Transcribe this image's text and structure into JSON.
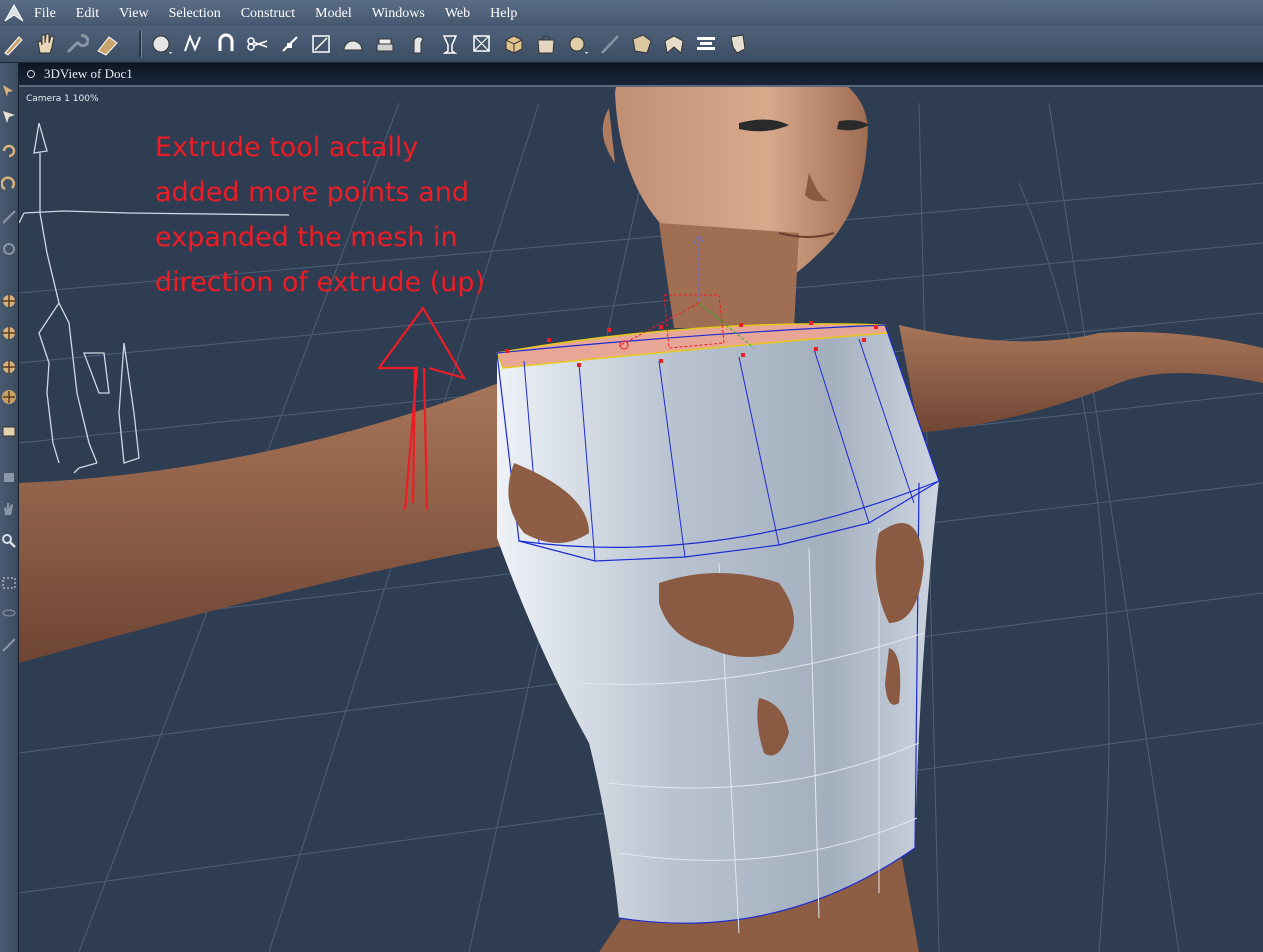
{
  "menubar": {
    "items": [
      "File",
      "Edit",
      "View",
      "Selection",
      "Construct",
      "Model",
      "Windows",
      "Web",
      "Help"
    ]
  },
  "toolbar": {
    "tools": [
      "paint-icon",
      "hand-icon",
      "wrench-icon",
      "eraser-icon",
      "sphere-icon",
      "polyline-icon",
      "magnet-icon",
      "scissors-icon",
      "pen-icon",
      "scale-icon",
      "dome-icon",
      "extrude-icon",
      "bend-icon",
      "lathe-icon",
      "box-x-icon",
      "cube-icon",
      "bag-icon",
      "globe-icon",
      "knife-icon",
      "move-icon",
      "fold-icon",
      "align-icon",
      "shard-icon"
    ],
    "highlighted_tool": "extrude-icon"
  },
  "leftbar": {
    "tools": [
      "arrow-icon",
      "select-icon",
      "rotate-icon",
      "twist-icon",
      "scale-tool-icon",
      "link-icon",
      "move-x-icon",
      "move-y-icon",
      "move-z-icon",
      "orbit-icon",
      "brush-icon",
      "lamp-icon",
      "hand-pan-icon",
      "zoom-icon",
      "marquee-icon",
      "eye-icon",
      "pencil-icon"
    ]
  },
  "viewport": {
    "title": "3DView of Doc1",
    "camera_label": "Camera 1 100%"
  },
  "annotation": {
    "text": "Extrude tool actally\nadded more points and\nexpanded the mesh in\ndirection of extrude (up)",
    "color": "#ee1c24"
  },
  "colors": {
    "viewport_bg": "#2e3d52",
    "grid": "#6a7c94",
    "skin": "#a8745a",
    "mesh": "#c9d3df",
    "mesh_edge": "#1a2bd6",
    "selection": "#ee1c24"
  }
}
